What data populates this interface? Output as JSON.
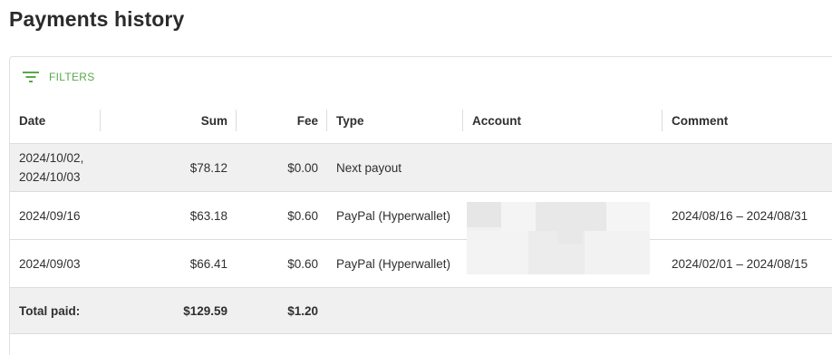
{
  "page_title": "Payments history",
  "filters_label": "FILTERS",
  "colors": {
    "accent": "#5aa84a",
    "row_highlight": "#f0f0f0",
    "border": "#dcdcdc"
  },
  "icons": {
    "filters": "filter-list-icon"
  },
  "columns": [
    "Date",
    "Sum",
    "Fee",
    "Type",
    "Account",
    "Comment"
  ],
  "rows": [
    {
      "date_line1": "2024/10/02,",
      "date_line2": "2024/10/03",
      "sum": "$78.12",
      "fee": "$0.00",
      "type": "Next payout",
      "account": "",
      "comment": ""
    },
    {
      "date": "2024/09/16",
      "sum": "$63.18",
      "fee": "$0.60",
      "type": "PayPal (Hyperwallet)",
      "account_redacted": true,
      "comment": "2024/08/16 – 2024/08/31"
    },
    {
      "date": "2024/09/03",
      "sum": "$66.41",
      "fee": "$0.60",
      "type": "PayPal (Hyperwallet)",
      "account_redacted": true,
      "comment": "2024/02/01 – 2024/08/15"
    }
  ],
  "total": {
    "label": "Total paid:",
    "sum": "$129.59",
    "fee": "$1.20"
  }
}
